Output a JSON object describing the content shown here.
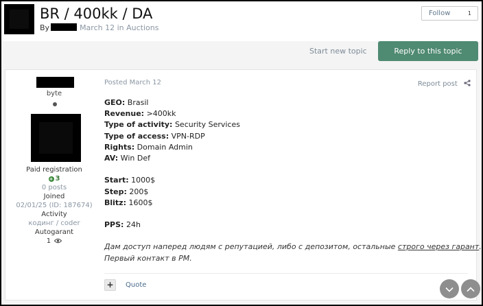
{
  "topic": {
    "title": "BR / 400kk / DA",
    "by_label": "By",
    "date_forum": "March 12 in Auctions",
    "follow_label": "Follow",
    "follow_count": "1"
  },
  "actions": {
    "start_new_topic": "Start new topic",
    "reply_label": "Reply to this topic"
  },
  "author": {
    "group": "byte",
    "paid": "Paid registration",
    "rep": "3",
    "posts": "0 posts",
    "joined_label": "Joined",
    "joined_value": "02/01/25 (ID: 187674)",
    "activity_label": "Activity",
    "activity_value": "кодинг / coder",
    "autogarant_label": "Autogarant",
    "autogarant_value": "1"
  },
  "post": {
    "posted": "Posted March 12",
    "report": "Report post",
    "lines": [
      {
        "label": "GEO:",
        "value": " Brasil"
      },
      {
        "label": "Revenue:",
        "value": " >400kk"
      },
      {
        "label": "Type of activity:",
        "value": " Security Services"
      },
      {
        "label": "Type of access:",
        "value": " VPN-RDP"
      },
      {
        "label": "Rights:",
        "value": " Domain Admin"
      },
      {
        "label": "AV:",
        "value": " Win Def"
      },
      {
        "label": "Start:",
        "value": " 1000$"
      },
      {
        "label": "Step:",
        "value": " 200$"
      },
      {
        "label": "Blitz:",
        "value": " 1600$"
      },
      {
        "label": "PPS:",
        "value": " 24h"
      }
    ],
    "note_part1": "Дам доступ наперед людям с репутацией, либо с депозитом, остальные ",
    "note_link": "строго через гарант",
    "note_part2": ".",
    "note_line2": "Первый контакт в PM.",
    "plus_label": "+",
    "quote": "Quote"
  },
  "icons": {
    "share": "share-icon",
    "eye": "eye-icon",
    "scroll_down": "chevron-down-icon",
    "scroll_up": "chevron-up-icon"
  }
}
